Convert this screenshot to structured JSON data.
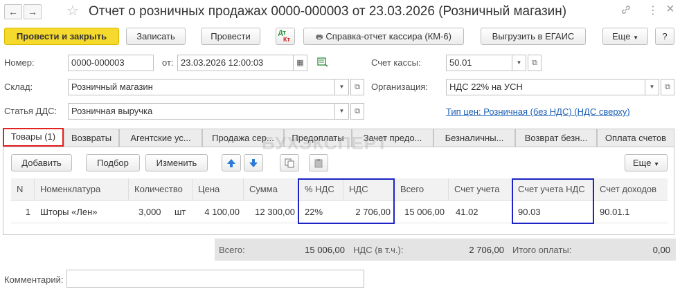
{
  "window": {
    "title": "Отчет о розничных продажах 0000-000003 от 23.03.2026 (Розничный магазин)",
    "back_glyph": "←",
    "forward_glyph": "→",
    "star_glyph": "☆",
    "link_glyph": "🔗",
    "more_glyph": "⋮",
    "close_glyph": "×"
  },
  "toolbar": {
    "post_and_close": "Провести и закрыть",
    "save": "Записать",
    "post": "Провести",
    "dt_kt_top": "Дт",
    "dt_kt_bottom": "Кт",
    "cashier_report": "Справка-отчет кассира (КМ-6)",
    "egais": "Выгрузить в ЕГАИС",
    "more": "Еще",
    "help": "?"
  },
  "header": {
    "number_label": "Номер:",
    "number_value": "0000-000003",
    "date_label": "от:",
    "date_value": "23.03.2026 12:00:03",
    "cash_account_label": "Счет кассы:",
    "cash_account_value": "50.01",
    "warehouse_label": "Склад:",
    "warehouse_value": "Розничный магазин",
    "organization_label": "Организация:",
    "organization_value": "НДС 22% на УСН",
    "dds_label": "Статья ДДС:",
    "dds_value": "Розничная выручка",
    "price_type_link": "Тип цен: Розничная (без НДС) (НДС сверху)"
  },
  "tabs": [
    {
      "label": "Товары (1)",
      "active": true
    },
    {
      "label": "Возвраты"
    },
    {
      "label": "Агентские ус..."
    },
    {
      "label": "Продажа сер..."
    },
    {
      "label": "Предоплаты"
    },
    {
      "label": "Зачет предо..."
    },
    {
      "label": "Безналичны..."
    },
    {
      "label": "Возврат безн..."
    },
    {
      "label": "Оплата счетов"
    }
  ],
  "watermark": "БУХЭКСПЕРТ",
  "table_toolbar": {
    "add": "Добавить",
    "pick": "Подбор",
    "edit": "Изменить",
    "more": "Еще"
  },
  "table": {
    "columns": [
      "N",
      "Номенклатура",
      "Количество",
      "Цена",
      "Сумма",
      "% НДС",
      "НДС",
      "Всего",
      "Счет учета",
      "Счет учета НДС",
      "Счет доходов"
    ],
    "rows": [
      {
        "n": "1",
        "item": "Шторы «Лен»",
        "qty": "3,000",
        "unit": "шт",
        "price": "4 100,00",
        "sum": "12 300,00",
        "vat_rate": "22%",
        "vat": "2 706,00",
        "total": "15 006,00",
        "account": "41.02",
        "vat_account": "90.03",
        "income_account": "90.01.1"
      }
    ]
  },
  "totals": {
    "total_label": "Всего:",
    "total_value": "15 006,00",
    "vat_label": "НДС (в т.ч.):",
    "vat_value": "2 706,00",
    "paid_label": "Итого оплаты:",
    "paid_value": "0,00"
  },
  "comment": {
    "label": "Комментарий:",
    "value": ""
  },
  "colors": {
    "primary_button": "#f5d92c",
    "active_tab_border": "#e32222",
    "highlight_border": "#1c22c4",
    "link": "#1a5fb4"
  }
}
